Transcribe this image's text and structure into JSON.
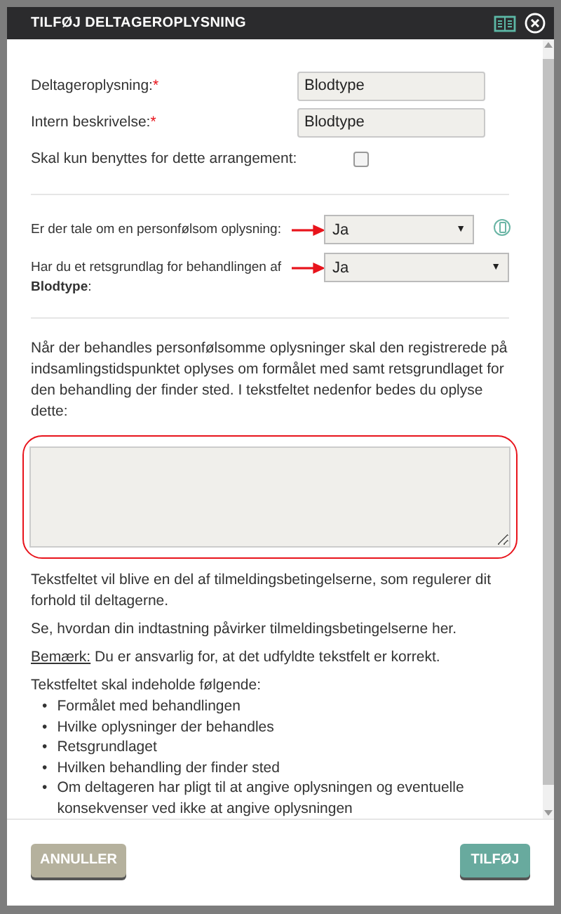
{
  "window": {
    "title": "TILFØJ DELTAGEROPLYSNING"
  },
  "fields": [
    {
      "label": "Deltageroplysning:",
      "required_mark": "*",
      "value": "Blodtype"
    },
    {
      "label": "Intern beskrivelse:",
      "required_mark": "*",
      "value": "Blodtype"
    }
  ],
  "only_this_event": {
    "label": "Skal kun benyttes for dette arrangement:",
    "checked": false
  },
  "questions": [
    {
      "label": "Er der tale om en personfølsom oplysning:",
      "value": "Ja",
      "caret": "▼",
      "info": true
    },
    {
      "label": "Har du et retsgrundlag for behandlingen af **Blodtype**:",
      "value": "Ja",
      "caret": "▼"
    }
  ],
  "intro": "Når der behandles personfølsomme oplysninger skal den registrerede på indsamlingstidspunktet oplyses om formålet med samt retsgrundlaget for den behandling der finder sted. I tekstfeltet nedenfor bedes du oplyse dette:",
  "after_text": "Tekstfeltet vil blive en del af tilmeldingsbetingelserne, som regulerer dit forhold til deltagerne.",
  "see_text": "Se, hvordan din indtastning påvirker tilmeldingsbetingelserne her.",
  "note": {
    "label": "Bemærk:",
    "text": " Du er ansvarlig for, at det udfyldte tekstfelt er korrekt."
  },
  "list_title": "Tekstfeltet skal indeholde følgende:",
  "list_items": [
    {
      "bullet": "•",
      "text": "Formålet med behandlingen"
    },
    {
      "bullet": "•",
      "text": "Hvilke oplysninger der behandles"
    },
    {
      "bullet": "•",
      "text": "Retsgrundlaget"
    },
    {
      "bullet": "•",
      "text": "Hvilken behandling der finder sted"
    },
    {
      "bullet": "•",
      "text": "Om deltageren har pligt til at angive oplysningen og eventuelle konsekvenser ved ikke at angive oplysningen"
    }
  ],
  "buttons": {
    "cancel": "ANNULLER",
    "submit": "TILFØJ"
  }
}
